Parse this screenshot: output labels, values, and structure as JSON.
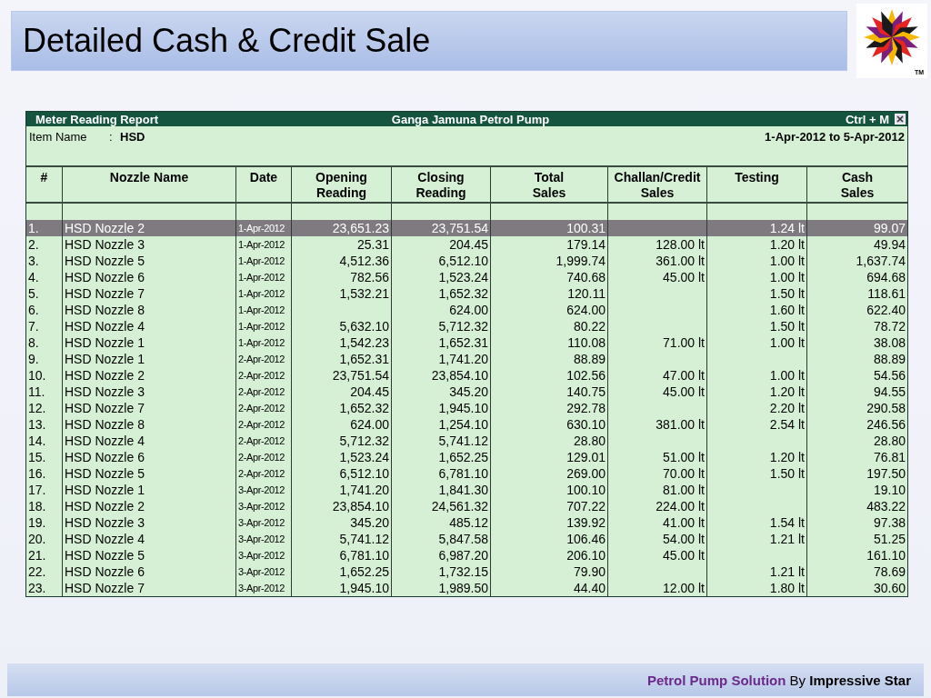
{
  "slide_title": "Detailed Cash & Credit Sale",
  "logo": {
    "mark": "TM"
  },
  "report": {
    "title": "Meter Reading Report",
    "company": "Ganga Jamuna Petrol Pump",
    "shortcut": "Ctrl + M",
    "item_label": "Item Name",
    "item_separator": ":",
    "item_value": "HSD",
    "period": "1-Apr-2012 to 5-Apr-2012",
    "columns": [
      {
        "lines": [
          "#"
        ]
      },
      {
        "lines": [
          "Nozzle Name"
        ]
      },
      {
        "lines": [
          "Date"
        ]
      },
      {
        "lines": [
          "Opening",
          "Reading"
        ]
      },
      {
        "lines": [
          "Closing",
          "Reading"
        ]
      },
      {
        "lines": [
          "Total",
          "Sales"
        ]
      },
      {
        "lines": [
          "Challan/Credit",
          "Sales"
        ]
      },
      {
        "lines": [
          "Testing"
        ]
      },
      {
        "lines": [
          "Cash",
          "Sales"
        ]
      }
    ],
    "rows": [
      {
        "selected": true,
        "cells": [
          "1.",
          "HSD Nozzle 2",
          "1-Apr-2012",
          "23,651.23",
          "23,751.54",
          "100.31",
          null,
          "1.24 lt",
          "99.07"
        ]
      },
      {
        "selected": false,
        "cells": [
          "2.",
          "HSD Nozzle 3",
          "1-Apr-2012",
          "25.31",
          "204.45",
          "179.14",
          "128.00 lt",
          "1.20 lt",
          "49.94"
        ]
      },
      {
        "selected": false,
        "cells": [
          "3.",
          "HSD Nozzle 5",
          "1-Apr-2012",
          "4,512.36",
          "6,512.10",
          "1,999.74",
          "361.00 lt",
          "1.00 lt",
          "1,637.74"
        ]
      },
      {
        "selected": false,
        "cells": [
          "4.",
          "HSD Nozzle 6",
          "1-Apr-2012",
          "782.56",
          "1,523.24",
          "740.68",
          "45.00 lt",
          "1.00 lt",
          "694.68"
        ]
      },
      {
        "selected": false,
        "cells": [
          "5.",
          "HSD Nozzle 7",
          "1-Apr-2012",
          "1,532.21",
          "1,652.32",
          "120.11",
          null,
          "1.50 lt",
          "118.61"
        ]
      },
      {
        "selected": false,
        "cells": [
          "6.",
          "HSD Nozzle 8",
          "1-Apr-2012",
          null,
          "624.00",
          "624.00",
          null,
          "1.60 lt",
          "622.40"
        ]
      },
      {
        "selected": false,
        "cells": [
          "7.",
          "HSD Nozzle 4",
          "1-Apr-2012",
          "5,632.10",
          "5,712.32",
          "80.22",
          null,
          "1.50 lt",
          "78.72"
        ]
      },
      {
        "selected": false,
        "cells": [
          "8.",
          "HSD Nozzle 1",
          "1-Apr-2012",
          "1,542.23",
          "1,652.31",
          "110.08",
          "71.00 lt",
          "1.00 lt",
          "38.08"
        ]
      },
      {
        "selected": false,
        "cells": [
          "9.",
          "HSD Nozzle 1",
          "2-Apr-2012",
          "1,652.31",
          "1,741.20",
          "88.89",
          null,
          null,
          "88.89"
        ]
      },
      {
        "selected": false,
        "cells": [
          "10.",
          "HSD Nozzle 2",
          "2-Apr-2012",
          "23,751.54",
          "23,854.10",
          "102.56",
          "47.00 lt",
          "1.00 lt",
          "54.56"
        ]
      },
      {
        "selected": false,
        "cells": [
          "11.",
          "HSD Nozzle 3",
          "2-Apr-2012",
          "204.45",
          "345.20",
          "140.75",
          "45.00 lt",
          "1.20 lt",
          "94.55"
        ]
      },
      {
        "selected": false,
        "cells": [
          "12.",
          "HSD Nozzle 7",
          "2-Apr-2012",
          "1,652.32",
          "1,945.10",
          "292.78",
          null,
          "2.20 lt",
          "290.58"
        ]
      },
      {
        "selected": false,
        "cells": [
          "13.",
          "HSD Nozzle 8",
          "2-Apr-2012",
          "624.00",
          "1,254.10",
          "630.10",
          "381.00 lt",
          "2.54 lt",
          "246.56"
        ]
      },
      {
        "selected": false,
        "cells": [
          "14.",
          "HSD Nozzle 4",
          "2-Apr-2012",
          "5,712.32",
          "5,741.12",
          "28.80",
          null,
          null,
          "28.80"
        ]
      },
      {
        "selected": false,
        "cells": [
          "15.",
          "HSD Nozzle 6",
          "2-Apr-2012",
          "1,523.24",
          "1,652.25",
          "129.01",
          "51.00 lt",
          "1.20 lt",
          "76.81"
        ]
      },
      {
        "selected": false,
        "cells": [
          "16.",
          "HSD Nozzle 5",
          "2-Apr-2012",
          "6,512.10",
          "6,781.10",
          "269.00",
          "70.00 lt",
          "1.50 lt",
          "197.50"
        ]
      },
      {
        "selected": false,
        "cells": [
          "17.",
          "HSD Nozzle 1",
          "3-Apr-2012",
          "1,741.20",
          "1,841.30",
          "100.10",
          "81.00 lt",
          null,
          "19.10"
        ]
      },
      {
        "selected": false,
        "cells": [
          "18.",
          "HSD Nozzle 2",
          "3-Apr-2012",
          "23,854.10",
          "24,561.32",
          "707.22",
          "224.00 lt",
          null,
          "483.22"
        ]
      },
      {
        "selected": false,
        "cells": [
          "19.",
          "HSD Nozzle 3",
          "3-Apr-2012",
          "345.20",
          "485.12",
          "139.92",
          "41.00 lt",
          "1.54 lt",
          "97.38"
        ]
      },
      {
        "selected": false,
        "cells": [
          "20.",
          "HSD Nozzle 4",
          "3-Apr-2012",
          "5,741.12",
          "5,847.58",
          "106.46",
          "54.00 lt",
          "1.21 lt",
          "51.25"
        ]
      },
      {
        "selected": false,
        "cells": [
          "21.",
          "HSD Nozzle 5",
          "3-Apr-2012",
          "6,781.10",
          "6,987.20",
          "206.10",
          "45.00 lt",
          null,
          "161.10"
        ]
      },
      {
        "selected": false,
        "cells": [
          "22.",
          "HSD Nozzle 6",
          "3-Apr-2012",
          "1,652.25",
          "1,732.15",
          "79.90",
          null,
          "1.21 lt",
          "78.69"
        ]
      },
      {
        "selected": false,
        "cells": [
          "23.",
          "HSD Nozzle 7",
          "3-Apr-2012",
          "1,945.10",
          "1,989.50",
          "44.40",
          "12.00 lt",
          "1.80 lt",
          "30.60"
        ]
      }
    ]
  },
  "footer": {
    "credit": "**Petrol Pump Solution** By **Impressive Star**"
  }
}
